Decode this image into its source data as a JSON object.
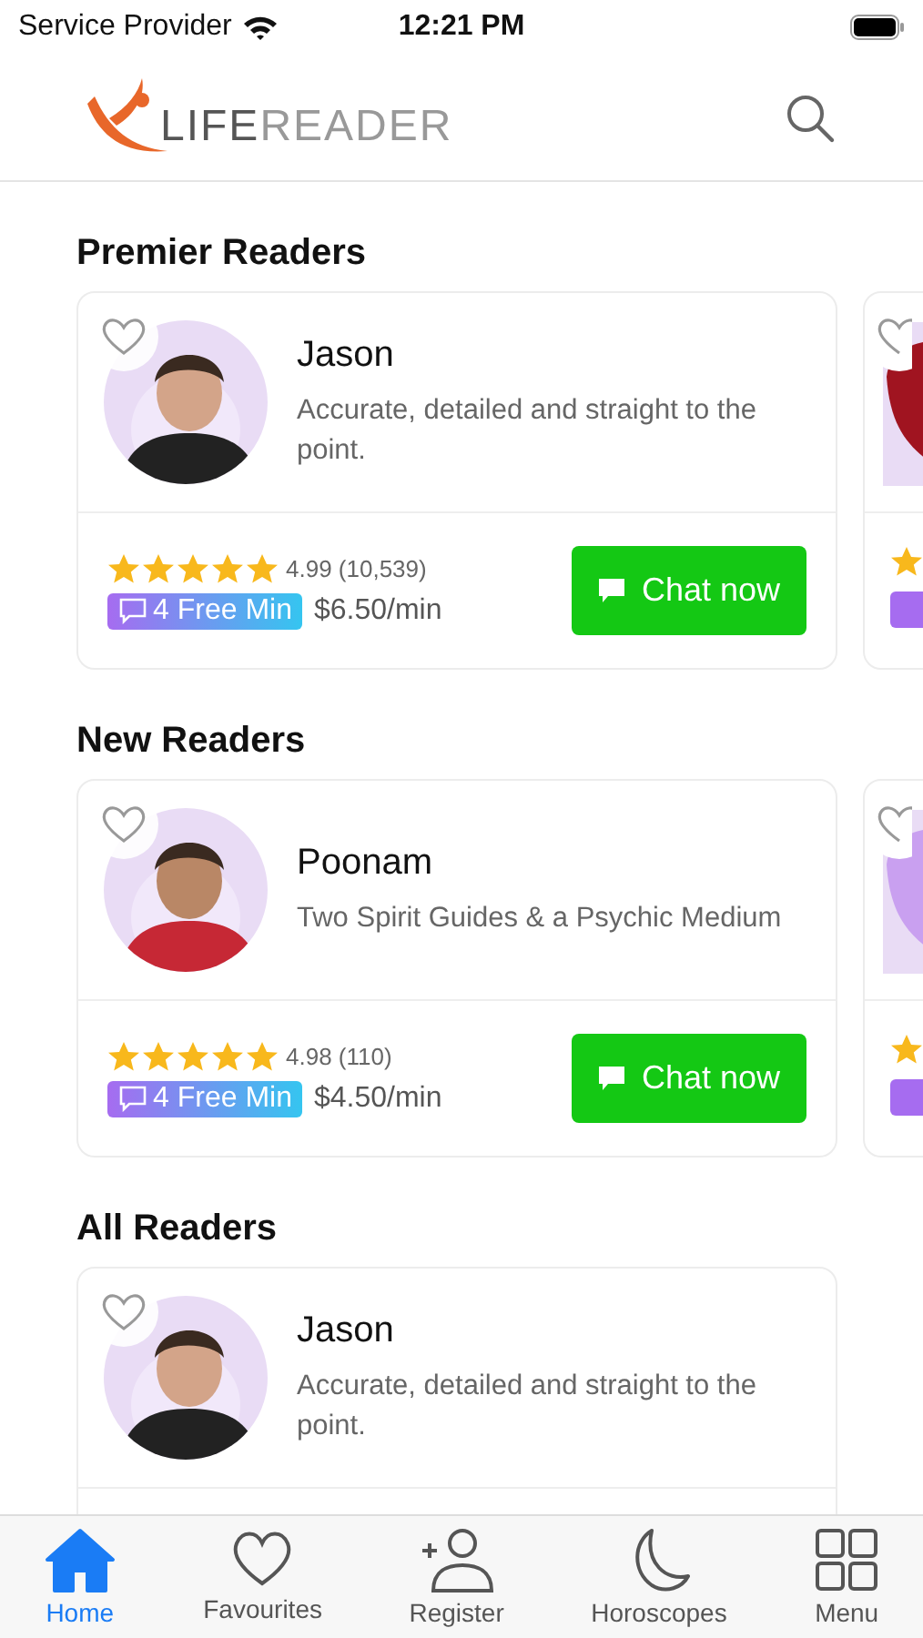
{
  "status_bar": {
    "carrier": "Service Provider",
    "time": "12:21 PM"
  },
  "header": {
    "logo_text_bold": "LIFE",
    "logo_text_light": "READER"
  },
  "sections": [
    {
      "title": "Premier Readers",
      "more_cards": true,
      "readers": [
        {
          "name": "Jason",
          "description": "Accurate, detailed and straight to the point.",
          "favourite": false,
          "stars": 5,
          "rating": "4.99 (10,539)",
          "badge": "4 Free Min",
          "price": "$6.50/min",
          "button": "Chat now"
        }
      ]
    },
    {
      "title": "New Readers",
      "more_cards": true,
      "readers": [
        {
          "name": "Poonam",
          "description": "Two Spirit Guides & a Psychic Medium",
          "favourite": false,
          "stars": 5,
          "rating": "4.98 (110)",
          "badge": "4 Free Min",
          "price": "$4.50/min",
          "button": "Chat now"
        }
      ]
    },
    {
      "title": "All Readers",
      "more_cards": false,
      "readers": [
        {
          "name": "Jason",
          "description": "Accurate, detailed and straight to the point.",
          "favourite": false
        }
      ]
    }
  ],
  "tab_bar": [
    {
      "label": "Home",
      "kind": "home",
      "selected": true
    },
    {
      "label": "Favourites",
      "kind": "heart",
      "selected": false
    },
    {
      "label": "Register",
      "kind": "register",
      "selected": false
    },
    {
      "label": "Horoscopes",
      "kind": "moon",
      "selected": false
    },
    {
      "label": "Menu",
      "kind": "grid",
      "selected": false
    }
  ]
}
